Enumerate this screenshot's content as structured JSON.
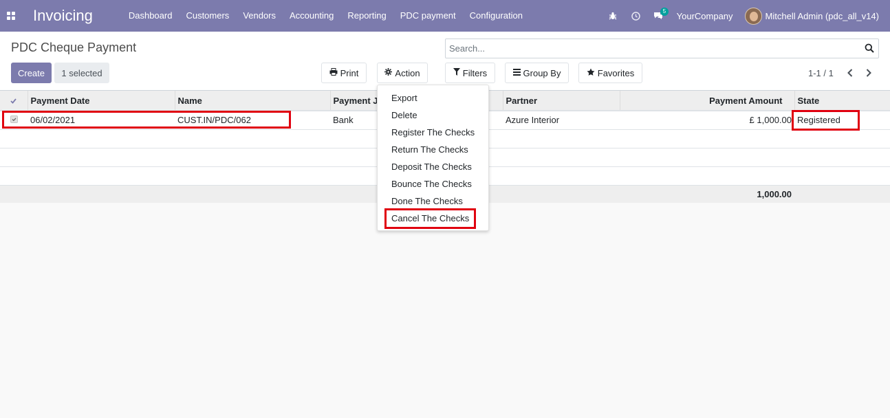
{
  "navbar": {
    "app_name": "Invoicing",
    "menu": [
      "Dashboard",
      "Customers",
      "Vendors",
      "Accounting",
      "Reporting",
      "PDC payment",
      "Configuration"
    ],
    "messages_badge": "5",
    "company": "YourCompany",
    "user": "Mitchell Admin (pdc_all_v14)",
    "accent_color": "#7c7bad"
  },
  "control_panel": {
    "title": "PDC Cheque Payment",
    "create_label": "Create",
    "selected_label": "1 selected",
    "print_label": "Print",
    "action_label": "Action",
    "filters_label": "Filters",
    "groupby_label": "Group By",
    "favorites_label": "Favorites",
    "search_placeholder": "Search...",
    "pager": "1-1 / 1"
  },
  "table": {
    "columns": [
      "Payment Date",
      "Name",
      "Payment Journal",
      "Partner",
      "Payment Amount",
      "State"
    ],
    "visible_header_journal": "Payment J",
    "rows": [
      {
        "date": "06/02/2021",
        "name": "CUST.IN/PDC/062",
        "journal": "Bank",
        "partner": "Azure Interior",
        "amount": "£ 1,000.00",
        "state": "Registered"
      }
    ],
    "total": "1,000.00"
  },
  "action_menu": {
    "items": [
      "Export",
      "Delete",
      "Register The Checks",
      "Return The Checks",
      "Deposit The Checks",
      "Bounce The Checks",
      "Done The Checks",
      "Cancel The Checks"
    ],
    "highlighted": "Cancel The Checks",
    "highlight_color": "#e0000f"
  }
}
